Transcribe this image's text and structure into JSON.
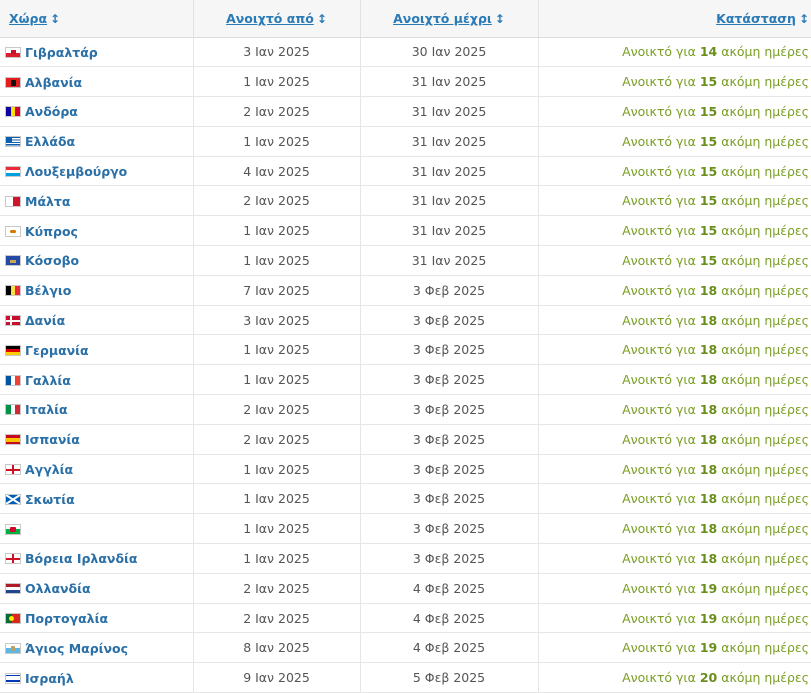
{
  "header": {
    "country": "Χώρα",
    "open_from": "Ανοιχτό από",
    "open_until": "Ανοιχτό μέχρι",
    "status": "Κατάσταση",
    "sort_glyph": "↕"
  },
  "status_prefix": "Ανοικτό για",
  "status_suffix": "ακόμη ημέρες",
  "rows": [
    {
      "country": "Γιβραλτάρ",
      "flag": "gibraltar-flag-icon",
      "from": "3 Ιαν 2025",
      "until": "30 Ιαν 2025",
      "days": "14"
    },
    {
      "country": "Αλβανία",
      "flag": "albania-flag-icon",
      "from": "1 Ιαν 2025",
      "until": "31 Ιαν 2025",
      "days": "15"
    },
    {
      "country": "Ανδόρα",
      "flag": "andorra-flag-icon",
      "from": "2 Ιαν 2025",
      "until": "31 Ιαν 2025",
      "days": "15"
    },
    {
      "country": "Ελλάδα",
      "flag": "greece-flag-icon",
      "from": "1 Ιαν 2025",
      "until": "31 Ιαν 2025",
      "days": "15"
    },
    {
      "country": "Λουξεμβούργο",
      "flag": "luxembourg-flag-icon",
      "from": "4 Ιαν 2025",
      "until": "31 Ιαν 2025",
      "days": "15"
    },
    {
      "country": "Μάλτα",
      "flag": "malta-flag-icon",
      "from": "2 Ιαν 2025",
      "until": "31 Ιαν 2025",
      "days": "15"
    },
    {
      "country": "Κύπρος",
      "flag": "cyprus-flag-icon",
      "from": "1 Ιαν 2025",
      "until": "31 Ιαν 2025",
      "days": "15"
    },
    {
      "country": "Κόσοβο",
      "flag": "kosovo-flag-icon",
      "from": "1 Ιαν 2025",
      "until": "31 Ιαν 2025",
      "days": "15"
    },
    {
      "country": "Βέλγιο",
      "flag": "belgium-flag-icon",
      "from": "7 Ιαν 2025",
      "until": "3 Φεβ 2025",
      "days": "18"
    },
    {
      "country": "Δανία",
      "flag": "denmark-flag-icon",
      "from": "3 Ιαν 2025",
      "until": "3 Φεβ 2025",
      "days": "18"
    },
    {
      "country": "Γερμανία",
      "flag": "germany-flag-icon",
      "from": "1 Ιαν 2025",
      "until": "3 Φεβ 2025",
      "days": "18"
    },
    {
      "country": "Γαλλία",
      "flag": "france-flag-icon",
      "from": "1 Ιαν 2025",
      "until": "3 Φεβ 2025",
      "days": "18"
    },
    {
      "country": "Ιταλία",
      "flag": "italy-flag-icon",
      "from": "2 Ιαν 2025",
      "until": "3 Φεβ 2025",
      "days": "18"
    },
    {
      "country": "Ισπανία",
      "flag": "spain-flag-icon",
      "from": "2 Ιαν 2025",
      "until": "3 Φεβ 2025",
      "days": "18"
    },
    {
      "country": "Αγγλία",
      "flag": "england-flag-icon",
      "from": "1 Ιαν 2025",
      "until": "3 Φεβ 2025",
      "days": "18"
    },
    {
      "country": "Σκωτία",
      "flag": "scotland-flag-icon",
      "from": "1 Ιαν 2025",
      "until": "3 Φεβ 2025",
      "days": "18"
    },
    {
      "country": "",
      "flag": "wales-flag-icon",
      "from": "1 Ιαν 2025",
      "until": "3 Φεβ 2025",
      "days": "18"
    },
    {
      "country": "Βόρεια Ιρλανδία",
      "flag": "northern-ireland-flag-icon",
      "from": "1 Ιαν 2025",
      "until": "3 Φεβ 2025",
      "days": "18"
    },
    {
      "country": "Ολλανδία",
      "flag": "netherlands-flag-icon",
      "from": "2 Ιαν 2025",
      "until": "4 Φεβ 2025",
      "days": "19"
    },
    {
      "country": "Πορτογαλία",
      "flag": "portugal-flag-icon",
      "from": "2 Ιαν 2025",
      "until": "4 Φεβ 2025",
      "days": "19"
    },
    {
      "country": "Άγιος Μαρίνος",
      "flag": "san-marino-flag-icon",
      "from": "8 Ιαν 2025",
      "until": "4 Φεβ 2025",
      "days": "19"
    },
    {
      "country": "Ισραήλ",
      "flag": "israel-flag-icon",
      "from": "9 Ιαν 2025",
      "until": "5 Φεβ 2025",
      "days": "20"
    }
  ],
  "colors": {
    "link": "#2a7ab6",
    "status_green": "#7a9e25",
    "header_bg": "#f6f6f6"
  }
}
